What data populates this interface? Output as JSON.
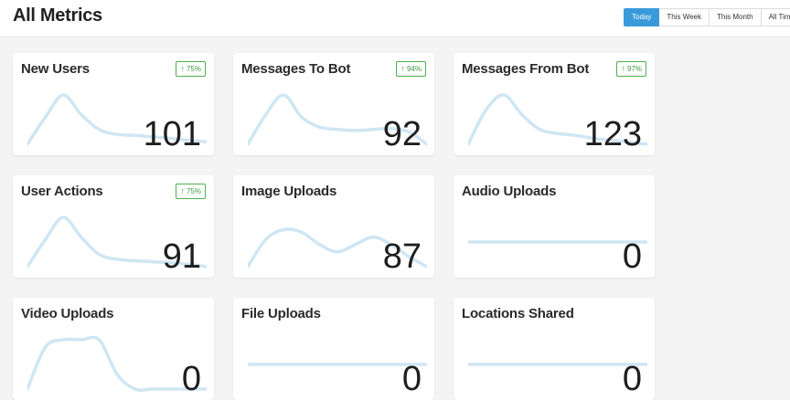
{
  "header": {
    "title": "All Metrics",
    "ranges": [
      "Today",
      "This Week",
      "This Month",
      "All Time"
    ],
    "active_range": "Today"
  },
  "colors": {
    "accent": "#3a9ad9",
    "badge": "#4caf50",
    "sparkline": "#cfe6f3"
  },
  "cards": [
    {
      "title": "New Users",
      "value": "101",
      "badge": "75%",
      "trend_icon": "arrow-up-icon",
      "trend": [
        0.0,
        0.55,
        1.0,
        0.6,
        0.3,
        0.2,
        0.18,
        0.15,
        0.12,
        0.08,
        0.05
      ]
    },
    {
      "title": "Messages To Bot",
      "value": "92",
      "badge": "94%",
      "trend_icon": "arrow-up-icon",
      "trend": [
        0.0,
        0.6,
        1.0,
        0.55,
        0.35,
        0.3,
        0.28,
        0.3,
        0.32,
        0.25,
        0.0
      ]
    },
    {
      "title": "Messages From Bot",
      "value": "123",
      "badge": "97%",
      "trend_icon": "arrow-up-icon",
      "trend": [
        0.0,
        0.7,
        1.0,
        0.6,
        0.3,
        0.22,
        0.18,
        0.12,
        0.08,
        0.04,
        0.0
      ]
    },
    {
      "title": "User Actions",
      "value": "91",
      "badge": "75%",
      "trend_icon": "arrow-up-icon",
      "trend": [
        0.0,
        0.55,
        1.0,
        0.6,
        0.25,
        0.15,
        0.12,
        0.1,
        0.08,
        0.05,
        0.0
      ]
    },
    {
      "title": "Image Uploads",
      "value": "87",
      "badge": "",
      "trend_icon": "",
      "trend": [
        0.0,
        0.55,
        0.75,
        0.7,
        0.45,
        0.3,
        0.45,
        0.6,
        0.45,
        0.2,
        0.0
      ]
    },
    {
      "title": "Audio Uploads",
      "value": "0",
      "badge": "",
      "trend_icon": "",
      "trend": [
        0.5,
        0.5,
        0.5,
        0.5,
        0.5,
        0.5,
        0.5,
        0.5,
        0.5,
        0.5,
        0.5
      ]
    },
    {
      "title": "Video Uploads",
      "value": "0",
      "badge": "",
      "trend_icon": "",
      "trend": [
        0.0,
        0.85,
        1.0,
        1.0,
        1.0,
        0.3,
        0.0,
        0.0,
        0.0,
        0.0,
        0.0
      ]
    },
    {
      "title": "File Uploads",
      "value": "0",
      "badge": "",
      "trend_icon": "",
      "trend": [
        0.5,
        0.5,
        0.5,
        0.5,
        0.5,
        0.5,
        0.5,
        0.5,
        0.5,
        0.5,
        0.5
      ]
    },
    {
      "title": "Locations Shared",
      "value": "0",
      "badge": "",
      "trend_icon": "",
      "trend": [
        0.5,
        0.5,
        0.5,
        0.5,
        0.5,
        0.5,
        0.5,
        0.5,
        0.5,
        0.5,
        0.5
      ]
    }
  ]
}
